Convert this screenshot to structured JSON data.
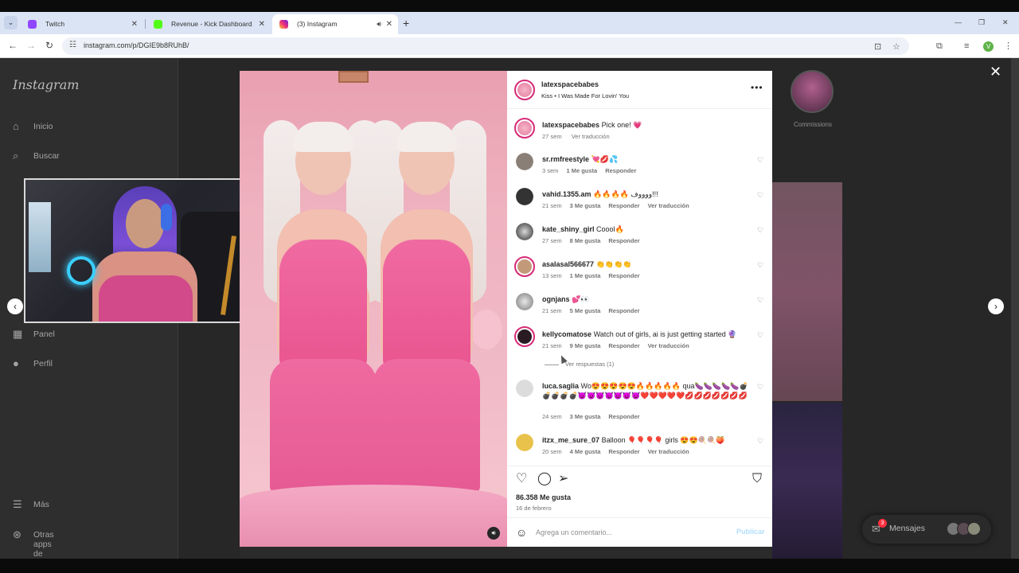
{
  "browser": {
    "tabs": [
      {
        "title": "Twitch",
        "active": false,
        "favicon_color": "#9146ff"
      },
      {
        "title": "Revenue - Kick Dashboard",
        "active": false,
        "favicon_color": "#53fc18"
      },
      {
        "title": "(3) Instagram",
        "active": true,
        "favicon_color": "#e1306c"
      }
    ],
    "new_tab_label": "+",
    "url": "instagram.com/p/DGIE9b8RUhB/",
    "profile_initial": "V"
  },
  "sidebar": {
    "logo": "Instagram",
    "items": [
      {
        "label": "Inicio",
        "icon": "home-icon"
      },
      {
        "label": "Buscar",
        "icon": "search-icon"
      },
      {
        "label": "Panel",
        "icon": "dashboard-icon"
      },
      {
        "label": "Perfil",
        "icon": "profile-avatar-icon"
      },
      {
        "label": "Más",
        "icon": "menu-icon"
      },
      {
        "label": "Otras apps de Meta",
        "icon": "meta-apps-icon"
      }
    ]
  },
  "background": {
    "avatar_label": "Commissions"
  },
  "post": {
    "username": "latexspacebabes",
    "audio": "Kiss • I Was Made For Lovin' You",
    "caption": {
      "user": "latexspacebabes",
      "text": "Pick one! 💗",
      "time": "27 sem",
      "translate": "Ver traducción"
    },
    "comments": [
      {
        "user": "sr.rmfreestyle",
        "text": "💘💋💦",
        "time": "3 sem",
        "likes": "1 Me gusta",
        "reply": "Responder",
        "translate": ""
      },
      {
        "user": "vahid.1355.am",
        "text": "🔥🔥🔥🔥 ووووف!!!",
        "time": "21 sem",
        "likes": "3 Me gusta",
        "reply": "Responder",
        "translate": "Ver traducción"
      },
      {
        "user": "kate_shiny_girl",
        "text": "Coool🔥",
        "time": "27 sem",
        "likes": "8 Me gusta",
        "reply": "Responder",
        "translate": ""
      },
      {
        "user": "asalasal566677",
        "text": "👏👏👏👏",
        "time": "13 sem",
        "likes": "1 Me gusta",
        "reply": "Responder",
        "translate": ""
      },
      {
        "user": "ognjans",
        "text": "💕👀",
        "time": "21 sem",
        "likes": "5 Me gusta",
        "reply": "Responder",
        "translate": ""
      },
      {
        "user": "kellycomatose",
        "text": "Watch out of girls, ai is just getting started 🔮",
        "time": "21 sem",
        "likes": "9 Me gusta",
        "reply": "Responder",
        "translate": "Ver traducción"
      },
      {
        "user": "luca.saglia",
        "text": "Wo😍😍😍😍😍🔥🔥🔥🔥🔥 qua🍆🍆🍆🍆🍆💣💣💣💣💣😈😈😈😈😈😈😈❤️❤️❤️❤️❤️💋💋💋💋💋💋💋",
        "time": "24 sem",
        "likes": "3 Me gusta",
        "reply": "Responder",
        "translate": ""
      },
      {
        "user": "itzx_me_sure_07",
        "text": "Balloon 🎈🎈🎈🎈 girls 😍😍🍭🍭🍑",
        "time": "20 sem",
        "likes": "4 Me gusta",
        "reply": "Responder",
        "translate": "Ver traducción"
      }
    ],
    "view_replies": "Ver respuestas (1)",
    "likes": "86.358 Me gusta",
    "date": "16 de febrero",
    "comment_placeholder": "Agrega un comentario...",
    "post_button": "Publicar"
  },
  "messages": {
    "label": "Mensajes",
    "badge": "3"
  },
  "colors": {
    "ig_ring": "#d62976",
    "link_blue": "#b2dffc",
    "badge_red": "#ff3040"
  }
}
